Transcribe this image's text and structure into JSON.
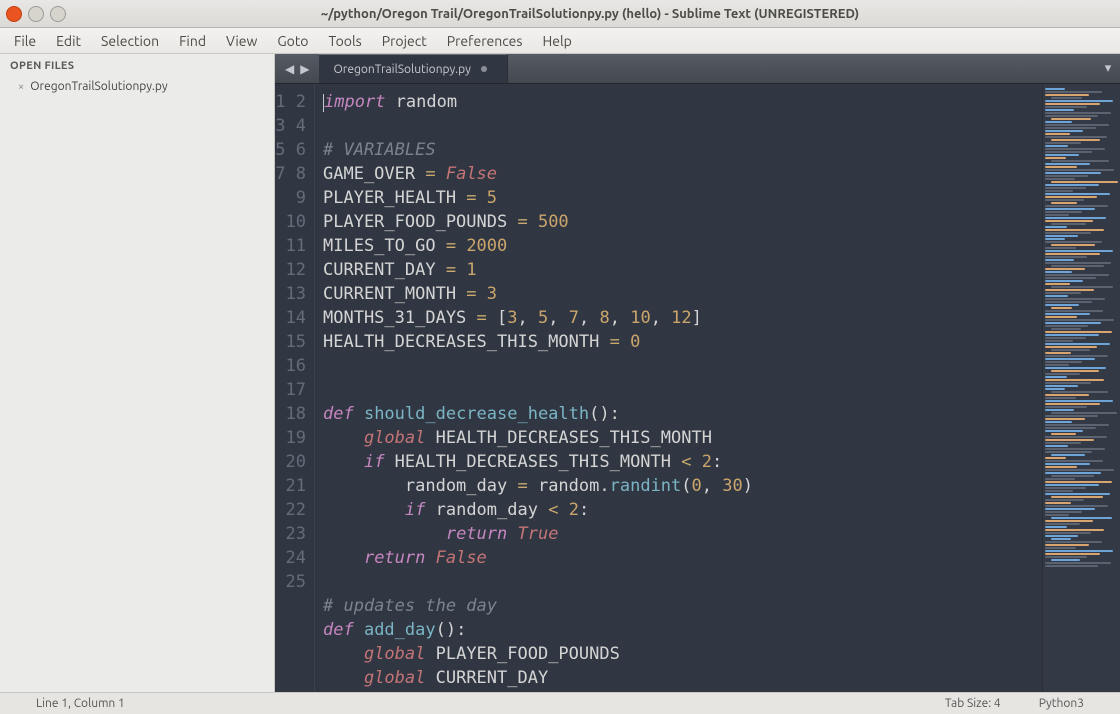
{
  "title": "~/python/Oregon Trail/OregonTrailSolutionpy.py (hello) - Sublime Text (UNREGISTERED)",
  "menu": [
    "File",
    "Edit",
    "Selection",
    "Find",
    "View",
    "Goto",
    "Tools",
    "Project",
    "Preferences",
    "Help"
  ],
  "sidebar": {
    "header": "OPEN FILES",
    "items": [
      {
        "close": "×",
        "name": "OregonTrailSolutionpy.py"
      }
    ]
  },
  "tabs": [
    {
      "label": "OregonTrailSolutionpy.py",
      "dirty": true,
      "active": true
    }
  ],
  "gutter_start": 1,
  "gutter_end": 25,
  "code_lines": [
    [
      {
        "t": "import ",
        "c": "kw"
      },
      {
        "t": "random",
        "c": "mod"
      }
    ],
    [],
    [
      {
        "t": "# VARIABLES",
        "c": "cmt"
      }
    ],
    [
      {
        "t": "GAME_OVER ",
        "c": "var"
      },
      {
        "t": "= ",
        "c": "op"
      },
      {
        "t": "False",
        "c": "bool"
      }
    ],
    [
      {
        "t": "PLAYER_HEALTH ",
        "c": "var"
      },
      {
        "t": "= ",
        "c": "op"
      },
      {
        "t": "5",
        "c": "num"
      }
    ],
    [
      {
        "t": "PLAYER_FOOD_POUNDS ",
        "c": "var"
      },
      {
        "t": "= ",
        "c": "op"
      },
      {
        "t": "500",
        "c": "num"
      }
    ],
    [
      {
        "t": "MILES_TO_GO ",
        "c": "var"
      },
      {
        "t": "= ",
        "c": "op"
      },
      {
        "t": "2000",
        "c": "num"
      }
    ],
    [
      {
        "t": "CURRENT_DAY ",
        "c": "var"
      },
      {
        "t": "= ",
        "c": "op"
      },
      {
        "t": "1",
        "c": "num"
      }
    ],
    [
      {
        "t": "CURRENT_MONTH ",
        "c": "var"
      },
      {
        "t": "= ",
        "c": "op"
      },
      {
        "t": "3",
        "c": "num"
      }
    ],
    [
      {
        "t": "MONTHS_31_DAYS ",
        "c": "var"
      },
      {
        "t": "= ",
        "c": "op"
      },
      {
        "t": "[",
        "c": "punc"
      },
      {
        "t": "3",
        "c": "num"
      },
      {
        "t": ", ",
        "c": "punc"
      },
      {
        "t": "5",
        "c": "num"
      },
      {
        "t": ", ",
        "c": "punc"
      },
      {
        "t": "7",
        "c": "num"
      },
      {
        "t": ", ",
        "c": "punc"
      },
      {
        "t": "8",
        "c": "num"
      },
      {
        "t": ", ",
        "c": "punc"
      },
      {
        "t": "10",
        "c": "num"
      },
      {
        "t": ", ",
        "c": "punc"
      },
      {
        "t": "12",
        "c": "num"
      },
      {
        "t": "]",
        "c": "punc"
      }
    ],
    [
      {
        "t": "HEALTH_DECREASES_THIS_MONTH ",
        "c": "var"
      },
      {
        "t": "= ",
        "c": "op"
      },
      {
        "t": "0",
        "c": "num"
      }
    ],
    [],
    [],
    [
      {
        "t": "def ",
        "c": "kw"
      },
      {
        "t": "should_decrease_health",
        "c": "fn"
      },
      {
        "t": "():",
        "c": "punc"
      }
    ],
    [
      {
        "t": "    ",
        "c": ""
      },
      {
        "t": "global ",
        "c": "self"
      },
      {
        "t": "HEALTH_DECREASES_THIS_MONTH",
        "c": "var"
      }
    ],
    [
      {
        "t": "    ",
        "c": ""
      },
      {
        "t": "if ",
        "c": "kw"
      },
      {
        "t": "HEALTH_DECREASES_THIS_MONTH ",
        "c": "var"
      },
      {
        "t": "< ",
        "c": "op"
      },
      {
        "t": "2",
        "c": "num"
      },
      {
        "t": ":",
        "c": "punc"
      }
    ],
    [
      {
        "t": "        random_day ",
        "c": "var"
      },
      {
        "t": "= ",
        "c": "op"
      },
      {
        "t": "random",
        "c": "var"
      },
      {
        "t": ".",
        "c": "punc"
      },
      {
        "t": "randint",
        "c": "call"
      },
      {
        "t": "(",
        "c": "punc"
      },
      {
        "t": "0",
        "c": "num"
      },
      {
        "t": ", ",
        "c": "punc"
      },
      {
        "t": "30",
        "c": "num"
      },
      {
        "t": ")",
        "c": "punc"
      }
    ],
    [
      {
        "t": "        ",
        "c": ""
      },
      {
        "t": "if ",
        "c": "kw"
      },
      {
        "t": "random_day ",
        "c": "var"
      },
      {
        "t": "< ",
        "c": "op"
      },
      {
        "t": "2",
        "c": "num"
      },
      {
        "t": ":",
        "c": "punc"
      }
    ],
    [
      {
        "t": "            ",
        "c": ""
      },
      {
        "t": "return ",
        "c": "kw"
      },
      {
        "t": "True",
        "c": "bool"
      }
    ],
    [
      {
        "t": "    ",
        "c": ""
      },
      {
        "t": "return ",
        "c": "kw"
      },
      {
        "t": "False",
        "c": "bool"
      }
    ],
    [],
    [
      {
        "t": "# updates the day",
        "c": "cmt"
      }
    ],
    [
      {
        "t": "def ",
        "c": "kw"
      },
      {
        "t": "add_day",
        "c": "fn"
      },
      {
        "t": "():",
        "c": "punc"
      }
    ],
    [
      {
        "t": "    ",
        "c": ""
      },
      {
        "t": "global ",
        "c": "self"
      },
      {
        "t": "PLAYER_FOOD_POUNDS",
        "c": "var"
      }
    ],
    [
      {
        "t": "    ",
        "c": ""
      },
      {
        "t": "global ",
        "c": "self"
      },
      {
        "t": "CURRENT_DAY",
        "c": "var"
      }
    ]
  ],
  "status": {
    "left": "Line 1, Column 1",
    "tab": "Tab Size: 4",
    "lang": "Python3"
  }
}
